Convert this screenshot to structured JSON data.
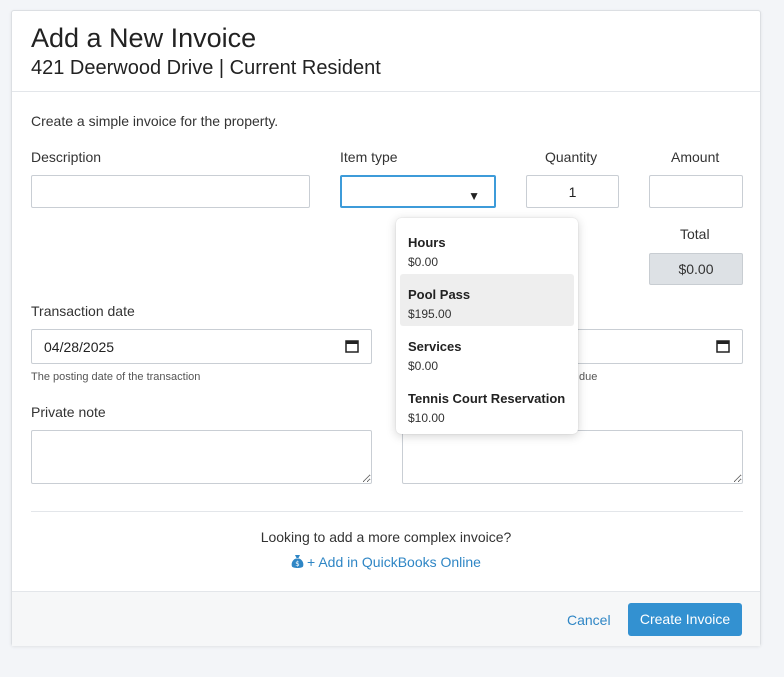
{
  "header": {
    "title": "Add a New Invoice",
    "subtitle": "421 Deerwood Drive | Current Resident"
  },
  "form": {
    "intro": "Create a simple invoice for the property.",
    "description_label": "Description",
    "description_value": "",
    "item_type_label": "Item type",
    "item_type_value": "",
    "quantity_label": "Quantity",
    "quantity_value": "1",
    "amount_label": "Amount",
    "amount_value": "",
    "total_label": "Total",
    "total_value": "$0.00",
    "transaction_date_label": "Transaction date",
    "transaction_date_value": "04/28/2025",
    "transaction_date_help": "The posting date of the transaction",
    "due_date_help_partial": "due",
    "private_note_label": "Private note"
  },
  "dropdown": {
    "options": [
      {
        "name": "Hours",
        "price": "$0.00"
      },
      {
        "name": "Pool Pass",
        "price": "$195.00"
      },
      {
        "name": "Services",
        "price": "$0.00"
      },
      {
        "name": "Tennis Court Reservation",
        "price": "$10.00"
      }
    ],
    "hovered_index": 1
  },
  "complex": {
    "prompt": "Looking to add a more complex invoice?",
    "link": "+ Add in QuickBooks Online"
  },
  "footer": {
    "cancel": "Cancel",
    "create": "Create Invoice"
  },
  "colors": {
    "accent": "#3391d1",
    "link": "#2f86c5",
    "focus": "#3d9bd9"
  },
  "icons": {
    "select_caret": "▼"
  }
}
